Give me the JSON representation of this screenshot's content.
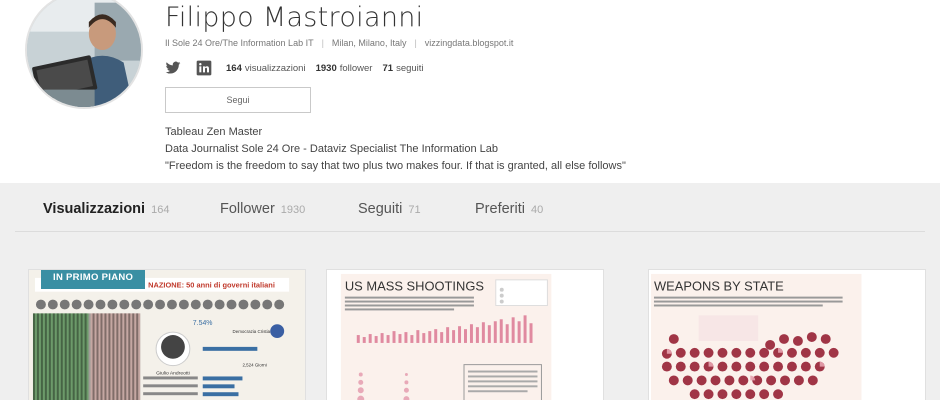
{
  "profile": {
    "name": "Filippo Mastroianni",
    "organization": "Il Sole 24 Ore/The Information Lab IT",
    "location": "Milan, Milano, Italy",
    "website": "vizzingdata.blogspot.it",
    "views_count": "164",
    "views_label": "visualizzazioni",
    "followers_count": "1930",
    "followers_label": "follower",
    "following_count": "71",
    "following_label": "seguiti",
    "follow_button": "Segui",
    "bio_line1": "Tableau Zen Master",
    "bio_line2": "Data Journalist Sole 24 Ore - Dataviz Specialist The Information Lab",
    "bio_line3": "\"Freedom is the freedom to say that two plus two makes four. If that is granted, all else follows\""
  },
  "tabs": [
    {
      "label": "Visualizzazioni",
      "count": "164"
    },
    {
      "label": "Follower",
      "count": "1930"
    },
    {
      "label": "Seguiti",
      "count": "71"
    },
    {
      "label": "Preferiti",
      "count": "40"
    }
  ],
  "cards": [
    {
      "badge": "IN PRIMO PIANO",
      "title": "NAZIONE: 50 anni di governi italiani",
      "stat": "7.54%",
      "person": "Giulio Andreotti",
      "side_label": "Democrazia Cristiana",
      "value": "2,524 Giorni"
    },
    {
      "title": "US MASS SHOOTINGS"
    },
    {
      "title": "WEAPONS BY STATE"
    }
  ],
  "colors": {
    "accent": "#3a8fa3",
    "band": "#efefef"
  },
  "icons": [
    "twitter-icon",
    "linkedin-icon"
  ]
}
